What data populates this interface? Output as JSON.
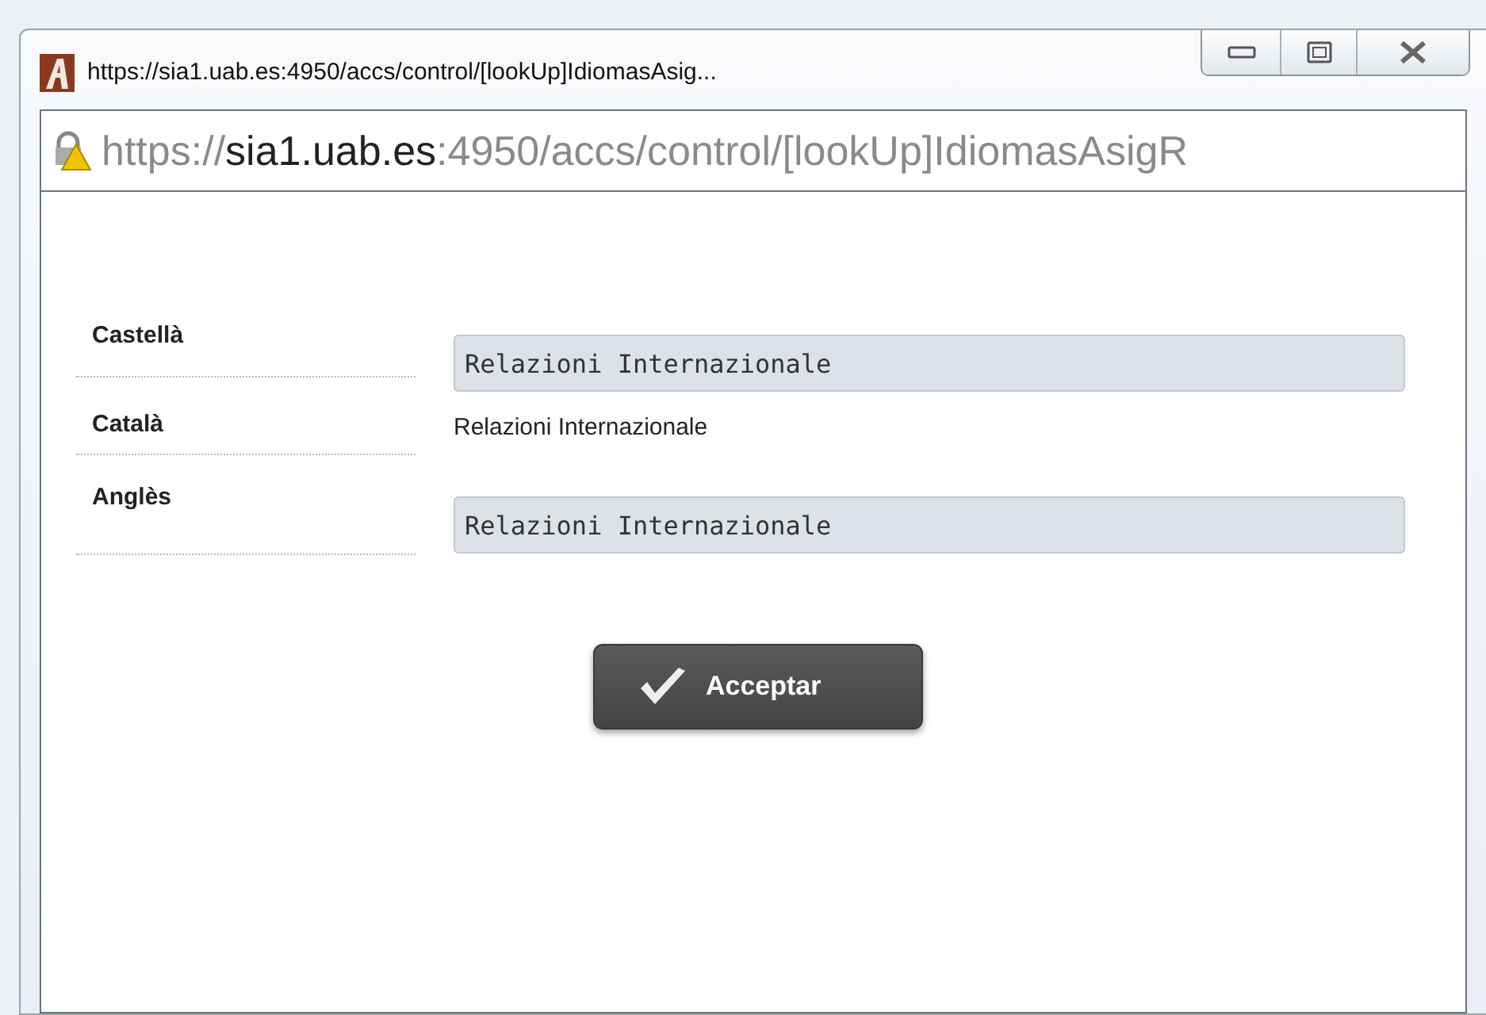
{
  "window": {
    "title": "https://sia1.uab.es:4950/accs/control/[lookUp]IdiomasAsig..."
  },
  "address": {
    "scheme": "https://",
    "host": "sia1.uab.es",
    "path": ":4950/accs/control/[lookUp]IdiomasAsigR"
  },
  "rows": [
    {
      "label": "Castellà",
      "kind": "field",
      "value": "Relazioni Internazionale"
    },
    {
      "label": "Català",
      "kind": "text",
      "value": "Relazioni Internazionale"
    },
    {
      "label": "Anglès",
      "kind": "field",
      "value": "Relazioni Internazionale"
    }
  ],
  "button": {
    "label": "Acceptar"
  }
}
